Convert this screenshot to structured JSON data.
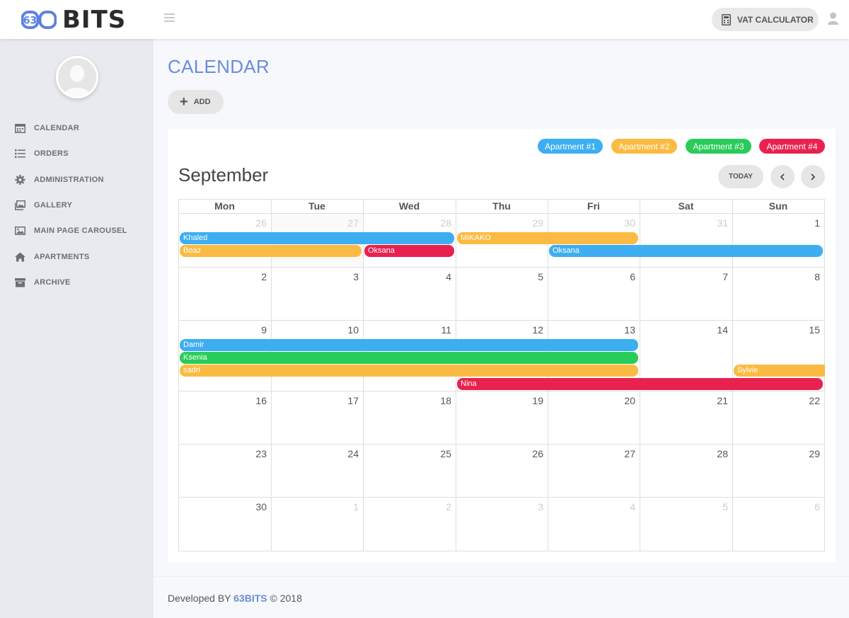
{
  "header": {
    "logo_number": "63",
    "logo_text": "BITS",
    "vat_label": "VAT CALCULATOR"
  },
  "sidebar": {
    "items": [
      {
        "label": "CALENDAR",
        "icon": "calendar-icon"
      },
      {
        "label": "ORDERS",
        "icon": "list-icon"
      },
      {
        "label": "ADMINISTRATION",
        "icon": "gear-icon"
      },
      {
        "label": "GALLERY",
        "icon": "gallery-icon"
      },
      {
        "label": "MAIN PAGE CAROUSEL",
        "icon": "image-icon"
      },
      {
        "label": "APARTMENTS",
        "icon": "home-icon"
      },
      {
        "label": "ARCHIVE",
        "icon": "archive-icon"
      }
    ]
  },
  "page": {
    "title": "CALENDAR",
    "add_label": "ADD"
  },
  "calendar": {
    "month": "September",
    "today_label": "TODAY",
    "legend": [
      {
        "label": "Apartment #1",
        "color": "#3daef1"
      },
      {
        "label": "Apartment #2",
        "color": "#fbbb42"
      },
      {
        "label": "Apartment #3",
        "color": "#29cc5a"
      },
      {
        "label": "Apartment #4",
        "color": "#e8224f"
      }
    ],
    "weekdays": [
      "Mon",
      "Tue",
      "Wed",
      "Thu",
      "Fri",
      "Sat",
      "Sun"
    ],
    "weeks": [
      [
        {
          "d": "26",
          "o": true
        },
        {
          "d": "27",
          "o": true
        },
        {
          "d": "28",
          "o": true
        },
        {
          "d": "29",
          "o": true
        },
        {
          "d": "30",
          "o": true
        },
        {
          "d": "31",
          "o": true
        },
        {
          "d": "1",
          "o": false
        }
      ],
      [
        {
          "d": "2",
          "o": false
        },
        {
          "d": "3",
          "o": false
        },
        {
          "d": "4",
          "o": false
        },
        {
          "d": "5",
          "o": false
        },
        {
          "d": "6",
          "o": false
        },
        {
          "d": "7",
          "o": false
        },
        {
          "d": "8",
          "o": false
        }
      ],
      [
        {
          "d": "9",
          "o": false
        },
        {
          "d": "10",
          "o": false
        },
        {
          "d": "11",
          "o": false
        },
        {
          "d": "12",
          "o": false
        },
        {
          "d": "13",
          "o": false
        },
        {
          "d": "14",
          "o": false
        },
        {
          "d": "15",
          "o": false
        }
      ],
      [
        {
          "d": "16",
          "o": false
        },
        {
          "d": "17",
          "o": false
        },
        {
          "d": "18",
          "o": false
        },
        {
          "d": "19",
          "o": false
        },
        {
          "d": "20",
          "o": false
        },
        {
          "d": "21",
          "o": false
        },
        {
          "d": "22",
          "o": false
        }
      ],
      [
        {
          "d": "23",
          "o": false
        },
        {
          "d": "24",
          "o": false
        },
        {
          "d": "25",
          "o": false
        },
        {
          "d": "26",
          "o": false
        },
        {
          "d": "27",
          "o": false
        },
        {
          "d": "28",
          "o": false
        },
        {
          "d": "29",
          "o": false
        }
      ],
      [
        {
          "d": "30",
          "o": false
        },
        {
          "d": "1",
          "o": true
        },
        {
          "d": "2",
          "o": true
        },
        {
          "d": "3",
          "o": true
        },
        {
          "d": "4",
          "o": true
        },
        {
          "d": "5",
          "o": true
        },
        {
          "d": "6",
          "o": true
        }
      ]
    ],
    "events": [
      {
        "name": "Khaled",
        "apartment": 1,
        "week": 0,
        "start": "Mon",
        "end": "Wed"
      },
      {
        "name": "MIKAKO",
        "apartment": 2,
        "week": 0,
        "start": "Thu",
        "end": "Fri"
      },
      {
        "name": "Boaz",
        "apartment": 2,
        "week": 0,
        "start": "Mon",
        "end": "Tue"
      },
      {
        "name": "Oksana",
        "apartment": 4,
        "week": 0,
        "start": "Wed",
        "end": "Wed"
      },
      {
        "name": "Oksana",
        "apartment": 1,
        "week": 0,
        "start": "Fri",
        "end": "Sun"
      },
      {
        "name": "Damir",
        "apartment": 1,
        "week": 2,
        "start": "Mon",
        "end": "Fri"
      },
      {
        "name": "Ksenia",
        "apartment": 3,
        "week": 2,
        "start": "Mon",
        "end": "Fri"
      },
      {
        "name": "sadri",
        "apartment": 2,
        "week": 2,
        "start": "Mon",
        "end": "Fri"
      },
      {
        "name": "Sylvie",
        "apartment": 2,
        "week": 2,
        "start": "Sun",
        "end": "Sun"
      },
      {
        "name": "Nina",
        "apartment": 4,
        "week": 2,
        "start": "Thu",
        "end": "Sun"
      }
    ]
  },
  "footer": {
    "prefix": "Developed BY ",
    "brand": "63BITS",
    "suffix": " © 2018"
  }
}
